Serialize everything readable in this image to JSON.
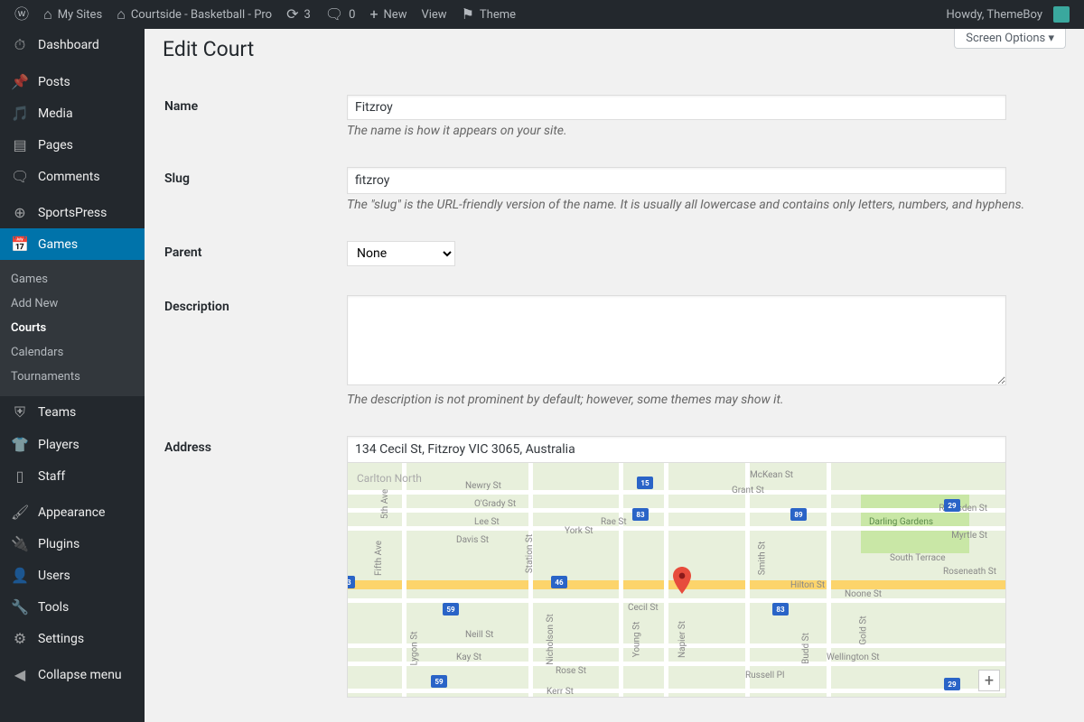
{
  "adminbar": {
    "my_sites": "My Sites",
    "site_name": "Courtside - Basketball - Pro",
    "updates": "3",
    "comments": "0",
    "new": "New",
    "view": "View",
    "theme": "Theme",
    "howdy": "Howdy, ThemeBoy"
  },
  "sidebar": {
    "dashboard": "Dashboard",
    "posts": "Posts",
    "media": "Media",
    "pages": "Pages",
    "comments": "Comments",
    "sportspress": "SportsPress",
    "games": "Games",
    "submenu": {
      "games": "Games",
      "add_new": "Add New",
      "courts": "Courts",
      "calendars": "Calendars",
      "tournaments": "Tournaments"
    },
    "teams": "Teams",
    "players": "Players",
    "staff": "Staff",
    "appearance": "Appearance",
    "plugins": "Plugins",
    "users": "Users",
    "tools": "Tools",
    "settings": "Settings",
    "collapse": "Collapse menu"
  },
  "screen_options": "Screen Options",
  "page_title": "Edit Court",
  "fields": {
    "name": {
      "label": "Name",
      "value": "Fitzroy",
      "desc": "The name is how it appears on your site."
    },
    "slug": {
      "label": "Slug",
      "value": "fitzroy",
      "desc": "The \"slug\" is the URL-friendly version of the name. It is usually all lowercase and contains only letters, numbers, and hyphens."
    },
    "parent": {
      "label": "Parent",
      "value": "None"
    },
    "description": {
      "label": "Description",
      "value": "",
      "desc": "The description is not prominent by default; however, some themes may show it."
    },
    "address": {
      "label": "Address",
      "value": "134 Cecil St, Fitzroy VIC 3065, Australia"
    }
  },
  "map": {
    "area_label": "Carlton North",
    "park_label": "Darling Gardens",
    "streets": [
      "Newry St",
      "O'Grady St",
      "Lee St",
      "Davis St",
      "York St",
      "Rae St",
      "Cecil St",
      "Neill St",
      "Kay St",
      "Rose St",
      "Kerr St",
      "Nicholson St",
      "Young St",
      "Napier St",
      "Smith St",
      "Wellington St",
      "Gold St",
      "Hilton St",
      "Noone St",
      "South Terrace",
      "Ramsden St",
      "Myrtle St",
      "Roseneath St",
      "Russell Pl",
      "5th Ave",
      "Fifth Ave",
      "McKean St",
      "Grant St",
      "Station St",
      "Budd St",
      "Lygon St"
    ],
    "shields": [
      "15",
      "29",
      "46",
      "59",
      "83",
      "89"
    ]
  }
}
